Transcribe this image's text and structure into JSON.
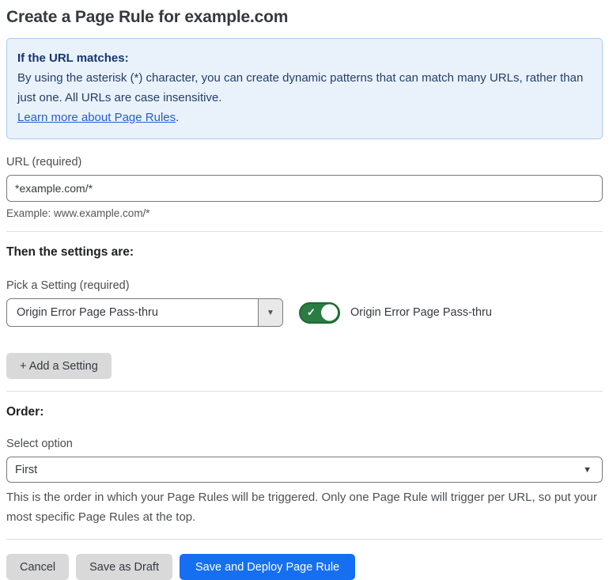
{
  "page": {
    "title": "Create a Page Rule for example.com"
  },
  "info_box": {
    "heading": "If the URL matches:",
    "body": "By using the asterisk (*) character, you can create dynamic patterns that can match many URLs, rather than just one. All URLs are case insensitive.",
    "link_label": "Learn more about Page Rules",
    "link_suffix": "."
  },
  "url_field": {
    "label": "URL (required)",
    "value": "*example.com/*",
    "example": "Example: www.example.com/*"
  },
  "settings_section": {
    "heading": "Then the settings are:",
    "pick_label": "Pick a Setting (required)",
    "selected_setting": "Origin Error Page Pass-thru",
    "toggle_state": "on",
    "toggle_label": "Origin Error Page Pass-thru",
    "add_button_label": "+ Add a Setting"
  },
  "order_section": {
    "heading": "Order:",
    "label": "Select option",
    "selected_option": "First",
    "help": "This is the order in which your Page Rules will be triggered. Only one Page Rule will trigger per URL, so put your most specific Page Rules at the top."
  },
  "footer": {
    "cancel_label": "Cancel",
    "save_draft_label": "Save as Draft",
    "save_deploy_label": "Save and Deploy Page Rule"
  },
  "icons": {
    "check": "✓",
    "dropdown_arrow": "▼"
  },
  "colors": {
    "primary_blue": "#156ff0",
    "toggle_green": "#2b7c43",
    "toggle_green_border": "#1e6b33",
    "info_bg": "#e9f2fb",
    "info_border": "#abccee",
    "info_heading_text": "#16356f",
    "info_body_text": "#253e66",
    "link_blue": "#2a5bd7",
    "neutral_button_bg": "#d9d9d9",
    "input_border": "#797979",
    "divider": "#dedede"
  }
}
